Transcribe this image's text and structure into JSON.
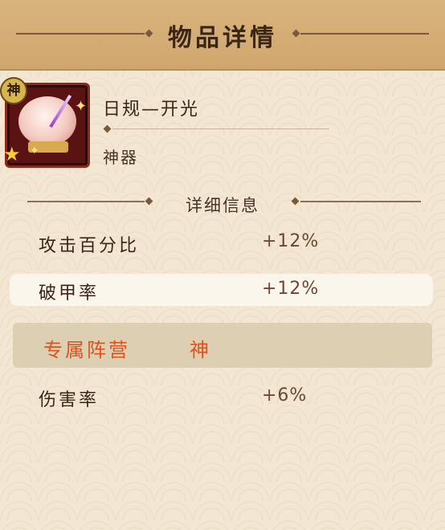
{
  "header": {
    "title": "物品详情"
  },
  "item": {
    "name": "日规—开光",
    "type": "神器",
    "badge": "神",
    "star": "★",
    "icon": "sundial-artifact-icon"
  },
  "details": {
    "title": "详细信息",
    "stats": [
      {
        "name": "攻击百分比",
        "value": "+12%"
      },
      {
        "name": "破甲率",
        "value": "+12%"
      }
    ],
    "faction": {
      "label": "专属阵营",
      "value": "神"
    },
    "extra": {
      "name": "伤害率",
      "value": "+6%"
    }
  },
  "colors": {
    "header_bg": "#d9b47e",
    "faction_text": "#e0501e",
    "frame": "#5a1212"
  }
}
